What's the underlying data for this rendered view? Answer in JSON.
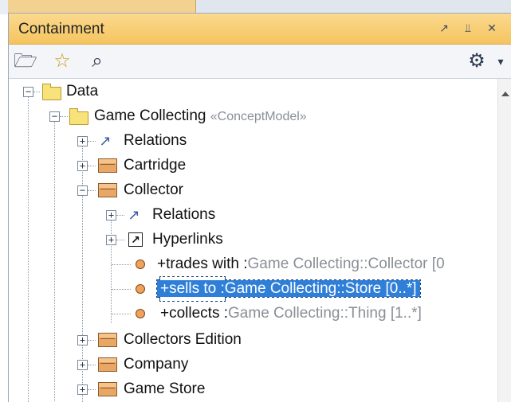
{
  "panel": {
    "title": "Containment",
    "title_icons": [
      "restore-icon",
      "pin-icon",
      "close-icon"
    ]
  },
  "toolbar": {
    "tools": [
      "open-folder-icon",
      "star-icon",
      "search-icon"
    ],
    "settings": "gear-icon"
  },
  "tree": {
    "data_label": "Data",
    "game_collecting_label": "Game Collecting",
    "game_collecting_stereotype": "«ConceptModel»",
    "relations_label": "Relations",
    "cartridge_label": "Cartridge",
    "collector_label": "Collector",
    "collector_relations_label": "Relations",
    "hyperlinks_label": "Hyperlinks",
    "trades_with": {
      "name": "+trades with : ",
      "type": "Game Collecting::Collector [0"
    },
    "sells_to": {
      "name": "+sells to : ",
      "type": "Game Collecting::Store [0..*]"
    },
    "collects": {
      "name": "+collects : ",
      "type": "Game Collecting::Thing [1..*]"
    },
    "collectors_edition_label": "Collectors Edition",
    "company_label": "Company",
    "game_store_label": "Game Store"
  },
  "colors": {
    "title_bar": "#f5c45f",
    "selection": "#2f7fd9"
  }
}
